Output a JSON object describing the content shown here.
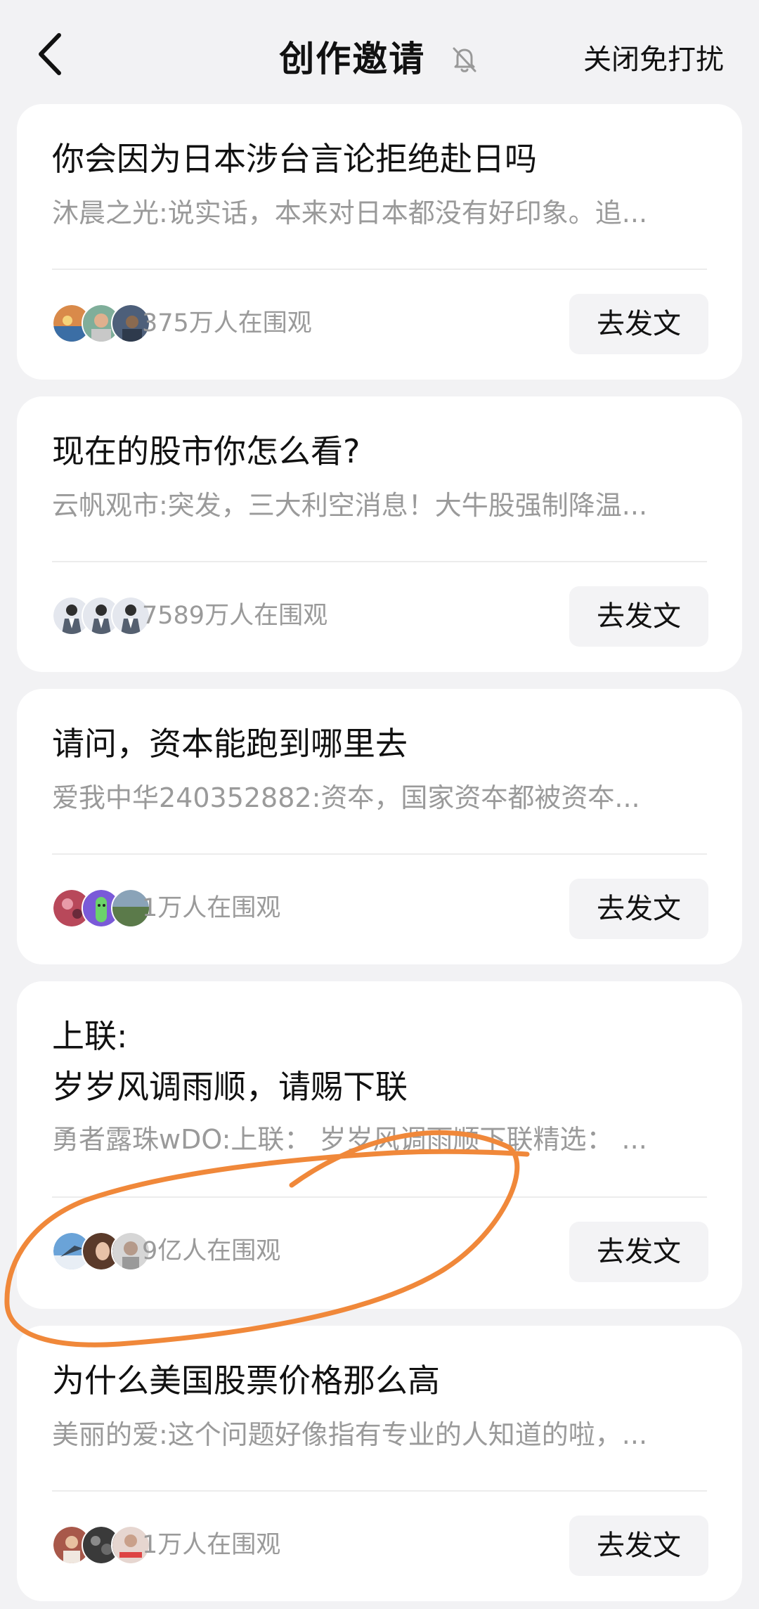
{
  "header": {
    "title": "创作邀请",
    "dnd_label": "关闭免打扰"
  },
  "colors": {
    "background": "#f2f2f4",
    "card": "#ffffff",
    "button": "#f3f3f5",
    "muted_text": "#9a9a9a",
    "annotation": "#f0883a"
  },
  "cards": [
    {
      "title": "你会因为日本涉台言论拒绝赴日吗",
      "snippet": "沐晨之光:说实话，本来对日本都没有好印象。追...",
      "watchers": "375万人在围观",
      "button": "去发文",
      "avatar_colors": [
        "#d98a4a",
        "#7fae9a",
        "#4d5f7a"
      ]
    },
    {
      "title": "现在的股市你怎么看?",
      "snippet": "云帆观市:突发，三大利空消息！大牛股强制降温...",
      "watchers": "7589万人在围观",
      "button": "去发文",
      "avatar_colors": [
        "#dfe3ea",
        "#dfe3ea",
        "#dfe3ea"
      ]
    },
    {
      "title": "请问，资本能跑到哪里去",
      "snippet": "爱我中华240352882:资夲，国家资夲都被资夲...",
      "watchers": "1万人在围观",
      "button": "去发文",
      "avatar_colors": [
        "#b8485a",
        "#6bb36a",
        "#5b7a4a"
      ]
    },
    {
      "title": "上联:\n岁岁风调雨顺，请赐下联",
      "snippet": "勇者露珠wDO:上联：  岁岁风调雨顺下联精选：  ...",
      "watchers": "9亿人在围观",
      "button": "去发文",
      "avatar_colors": [
        "#6aa3d8",
        "#5a3a2a",
        "#c9c9c9"
      ]
    },
    {
      "title": "为什么美国股票价格那么高",
      "snippet": "美丽的爱:这个问题好像指有专业的人知道的啦，...",
      "watchers": "1万人在围观",
      "button": "去发文",
      "avatar_colors": [
        "#a8584a",
        "#3a3a3a",
        "#e6d6d0"
      ]
    }
  ]
}
